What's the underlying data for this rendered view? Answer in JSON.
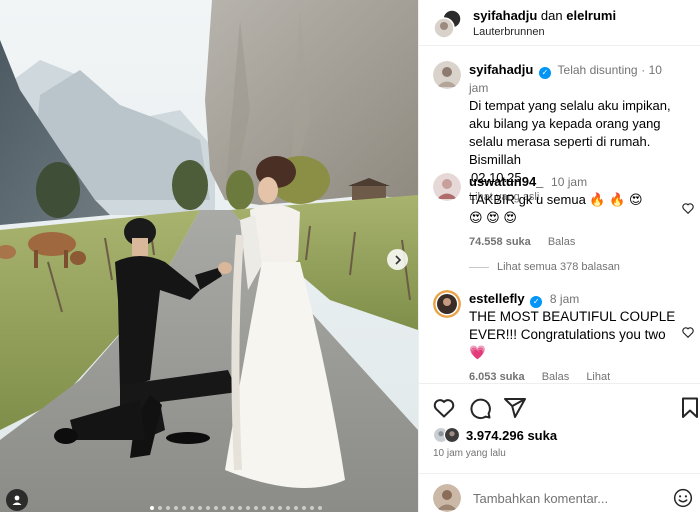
{
  "header": {
    "user1": "syifahadju",
    "joiner": "dan",
    "user2": "elelrumi",
    "location": "Lauterbrunnen"
  },
  "caption": {
    "username": "syifahadju",
    "status": "Telah disunting",
    "time": "10 jam",
    "text": "Di tempat yang selalu aku impikan, aku bilang ya kepada orang yang selalu merasa seperti di rumah. Bismillah",
    "date": "02.10.25",
    "see_original": "Lihat yang asli"
  },
  "comments": [
    {
      "username": "uswatun94_",
      "time": "10 jam",
      "text": "TAKBIR gk u semua 🔥 🔥 😍",
      "text2": "😍 😍 😍",
      "likes": "74.558 suka",
      "reply": "Balas"
    },
    {
      "username": "estellefly",
      "time": "8 jam",
      "text": "THE MOST BEAUTIFUL COUPLE EVER!!! Congratulations you two 💗",
      "likes": "6.053 suka",
      "reply": "Balas",
      "translate": "Lihat terjemahan"
    }
  ],
  "view_replies": "Lihat semua 378 balasan",
  "post": {
    "likes": "3.974.296 suka",
    "ago": "10 jam yang lalu"
  },
  "add_comment": {
    "placeholder": "Tambahkan komentar..."
  },
  "icons": [
    "heart-icon",
    "comment-icon",
    "share-icon",
    "bookmark-icon",
    "emoji-icon",
    "chevron-right-icon",
    "tag-user-icon",
    "verified-icon"
  ],
  "colors": {
    "verified": "#0095f6",
    "muted": "#737373",
    "border": "#efefef"
  }
}
